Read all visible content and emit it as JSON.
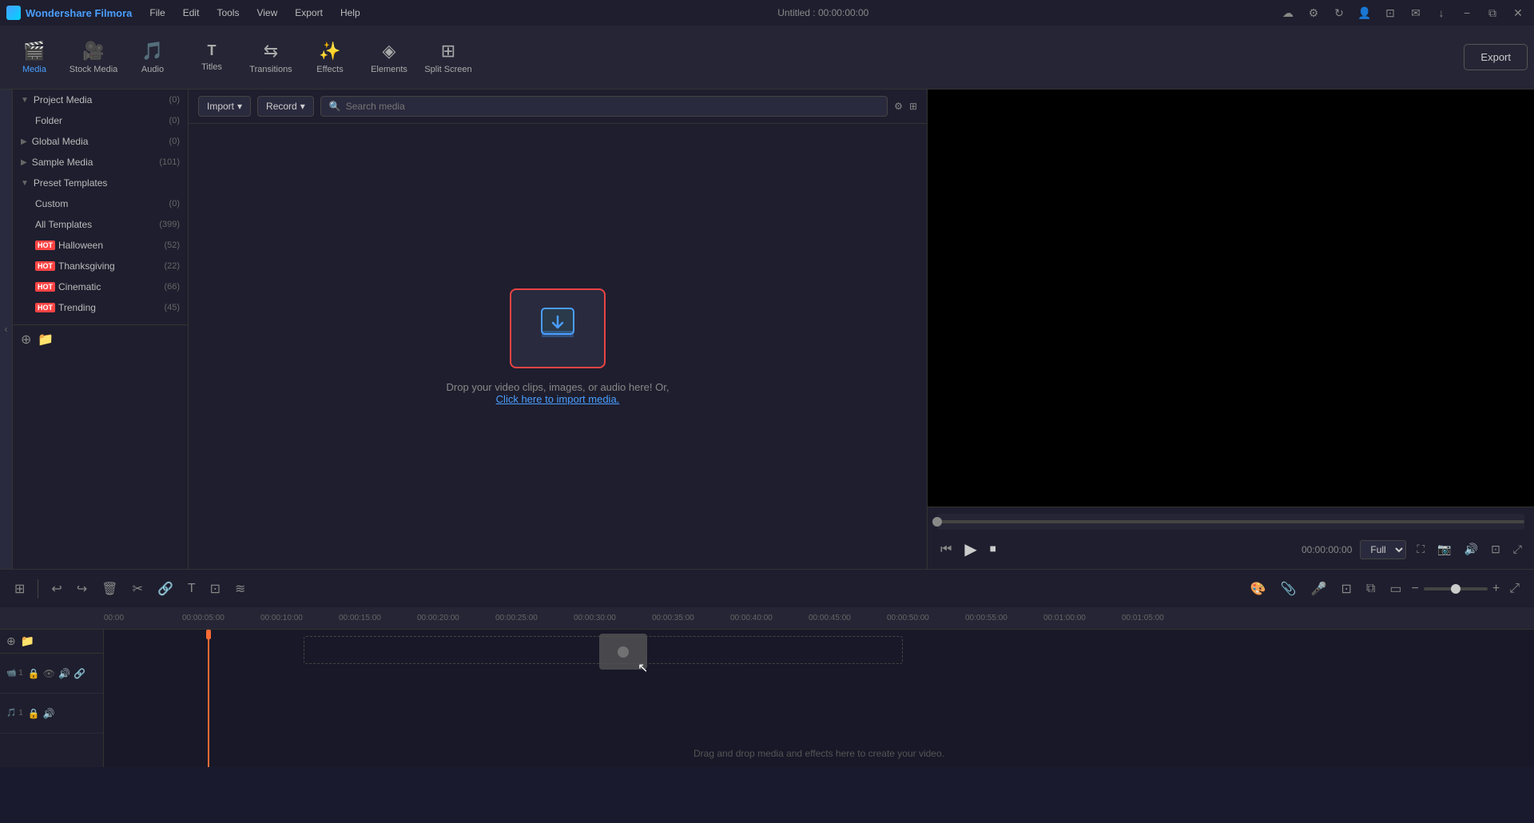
{
  "app": {
    "name": "Wondershare Filmora",
    "title": "Untitled : 00:00:00:00"
  },
  "menu": {
    "items": [
      "File",
      "Edit",
      "Tools",
      "View",
      "Export",
      "Help"
    ]
  },
  "toolbar": {
    "items": [
      {
        "id": "media",
        "icon": "🎬",
        "label": "Media",
        "active": true
      },
      {
        "id": "stock-media",
        "icon": "🎥",
        "label": "Stock Media",
        "active": false
      },
      {
        "id": "audio",
        "icon": "🎵",
        "label": "Audio",
        "active": false
      },
      {
        "id": "titles",
        "icon": "T",
        "label": "Titles",
        "active": false
      },
      {
        "id": "transitions",
        "icon": "⧖",
        "label": "Transitions",
        "active": false
      },
      {
        "id": "effects",
        "icon": "✨",
        "label": "Effects",
        "active": false
      },
      {
        "id": "elements",
        "icon": "◈",
        "label": "Elements",
        "active": false
      },
      {
        "id": "split-screen",
        "icon": "⊞",
        "label": "Split Screen",
        "active": false
      }
    ],
    "export_label": "Export"
  },
  "media_toolbar": {
    "import_label": "Import",
    "record_label": "Record",
    "search_placeholder": "Search media"
  },
  "sidebar": {
    "items": [
      {
        "id": "project-media",
        "label": "Project Media",
        "count": "(0)",
        "level": "parent",
        "expanded": true,
        "hot": false
      },
      {
        "id": "folder",
        "label": "Folder",
        "count": "(0)",
        "level": "child",
        "hot": false
      },
      {
        "id": "global-media",
        "label": "Global Media",
        "count": "(0)",
        "level": "parent",
        "hot": false
      },
      {
        "id": "sample-media",
        "label": "Sample Media",
        "count": "(101)",
        "level": "parent",
        "hot": false
      },
      {
        "id": "preset-templates",
        "label": "Preset Templates",
        "count": "",
        "level": "parent",
        "expanded": true,
        "hot": false
      },
      {
        "id": "custom",
        "label": "Custom",
        "count": "(0)",
        "level": "child",
        "hot": false
      },
      {
        "id": "all-templates",
        "label": "All Templates",
        "count": "(399)",
        "level": "child",
        "hot": false
      },
      {
        "id": "halloween",
        "label": "Halloween",
        "count": "(52)",
        "level": "child",
        "hot": true
      },
      {
        "id": "thanksgiving",
        "label": "Thanksgiving",
        "count": "(22)",
        "level": "child",
        "hot": true
      },
      {
        "id": "cinematic",
        "label": "Cinematic",
        "count": "(66)",
        "level": "child",
        "hot": true
      },
      {
        "id": "trending",
        "label": "Trending",
        "count": "(45)",
        "level": "child",
        "hot": true
      }
    ]
  },
  "drop_zone": {
    "main_text": "Drop your video clips, images, or audio here! Or,",
    "link_text": "Click here to import media."
  },
  "preview": {
    "time": "00:00:00:00",
    "quality": "Full"
  },
  "timeline": {
    "ruler_marks": [
      "00:00",
      "00:00:05:00",
      "00:00:10:00",
      "00:00:15:00",
      "00:00:20:00",
      "00:00:25:00",
      "00:00:30:00",
      "00:00:35:00",
      "00:00:40:00",
      "00:00:45:00",
      "00:00:50:00",
      "00:00:55:00",
      "00:01:00:00",
      "00:01:05:00"
    ],
    "drop_text": "Drag and drop media and effects here to create your video.",
    "tracks": [
      {
        "id": "video-1",
        "type": "video",
        "number": "1"
      },
      {
        "id": "audio-1",
        "type": "audio",
        "number": "1"
      }
    ]
  },
  "title_bar_buttons": [
    "⊡",
    "🔔",
    "↑",
    "−",
    "⧉",
    "✕"
  ]
}
